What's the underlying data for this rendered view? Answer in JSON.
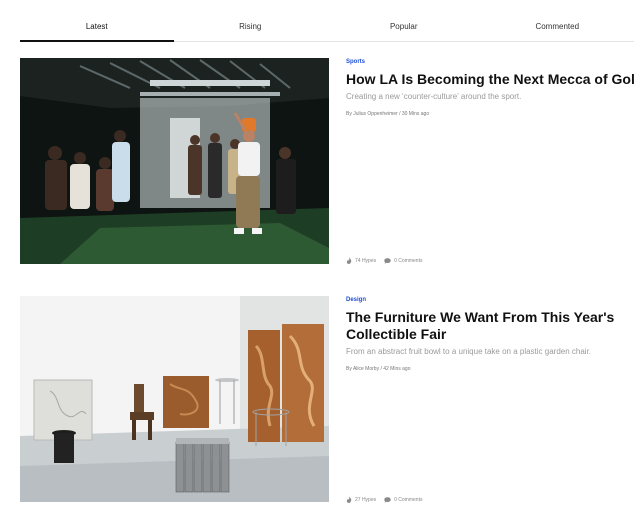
{
  "tabs": [
    {
      "label": "Latest",
      "active": true
    },
    {
      "label": "Rising",
      "active": false
    },
    {
      "label": "Popular",
      "active": false
    },
    {
      "label": "Commented",
      "active": false
    }
  ],
  "articles": [
    {
      "category": "Sports",
      "title": "How LA Is Becoming the Next Mecca of Golf",
      "subtitle": "Creating a new ‘counter-culture’ around the sport.",
      "byline": "By Julius Oppenheimer / 30 Mins ago",
      "hypes": "74 Hypes",
      "comments": "0 Comments"
    },
    {
      "category": "Design",
      "title": "The Furniture We Want From This Year's Collectible Fair",
      "subtitle": "From an abstract fruit bowl to a unique take on a plastic garden chair.",
      "byline": "By Alice Morby / 42 Mins ago",
      "hypes": "27 Hypes",
      "comments": "0 Comments"
    }
  ],
  "colors": {
    "accent": "#1f4fd6"
  },
  "icons": {
    "hype": "flame-icon",
    "comment": "speech-bubble-icon"
  }
}
